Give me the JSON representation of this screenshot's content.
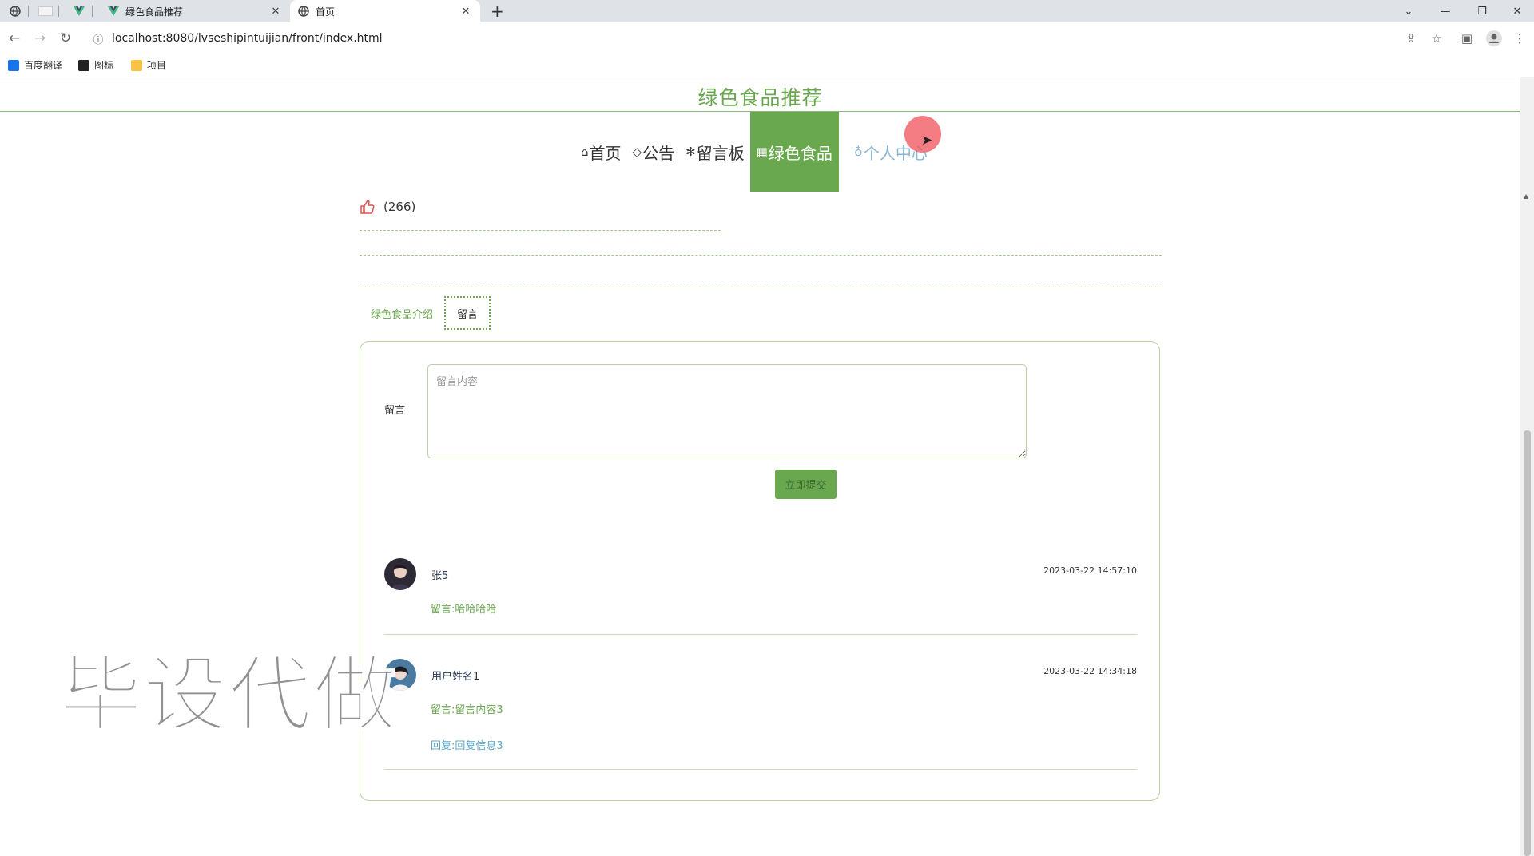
{
  "browser": {
    "tabs": [
      {
        "title": "绿色食品推荐",
        "active": false
      },
      {
        "title": "首页",
        "active": true
      }
    ],
    "url": "localhost:8080/lvseshipintuijian/front/index.html",
    "bookmarks": [
      {
        "label": "百度翻译",
        "color": "#1a73e8"
      },
      {
        "label": "图标",
        "color": "#222222"
      },
      {
        "label": "项目",
        "color": "#f6c343"
      }
    ]
  },
  "site": {
    "title": "绿色食品推荐",
    "accent_color": "#6aa84f"
  },
  "nav": [
    {
      "glyph": "⌂",
      "label": "首页"
    },
    {
      "glyph": "◇",
      "label": "公告"
    },
    {
      "glyph": "✻",
      "label": "留言板"
    },
    {
      "glyph": "▦",
      "label": "绿色食品"
    },
    {
      "glyph": "♁",
      "label": "个人中心"
    }
  ],
  "likes": {
    "count_text": "(266)"
  },
  "detail_tabs": [
    {
      "label": "绿色食品介绍",
      "active": false
    },
    {
      "label": "留言",
      "active": true
    }
  ],
  "form": {
    "label": "留言",
    "placeholder": "留言内容",
    "value": "",
    "submit_label": "立即提交"
  },
  "comments": [
    {
      "name": "张5",
      "time": "2023-03-22 14:57:10",
      "text": "留言:哈哈哈哈",
      "reply": null
    },
    {
      "name": "用户姓名1",
      "time": "2023-03-22 14:34:18",
      "text": "留言:留言内容3",
      "reply": "回复:回复信息3"
    }
  ],
  "watermark": "毕设代做"
}
